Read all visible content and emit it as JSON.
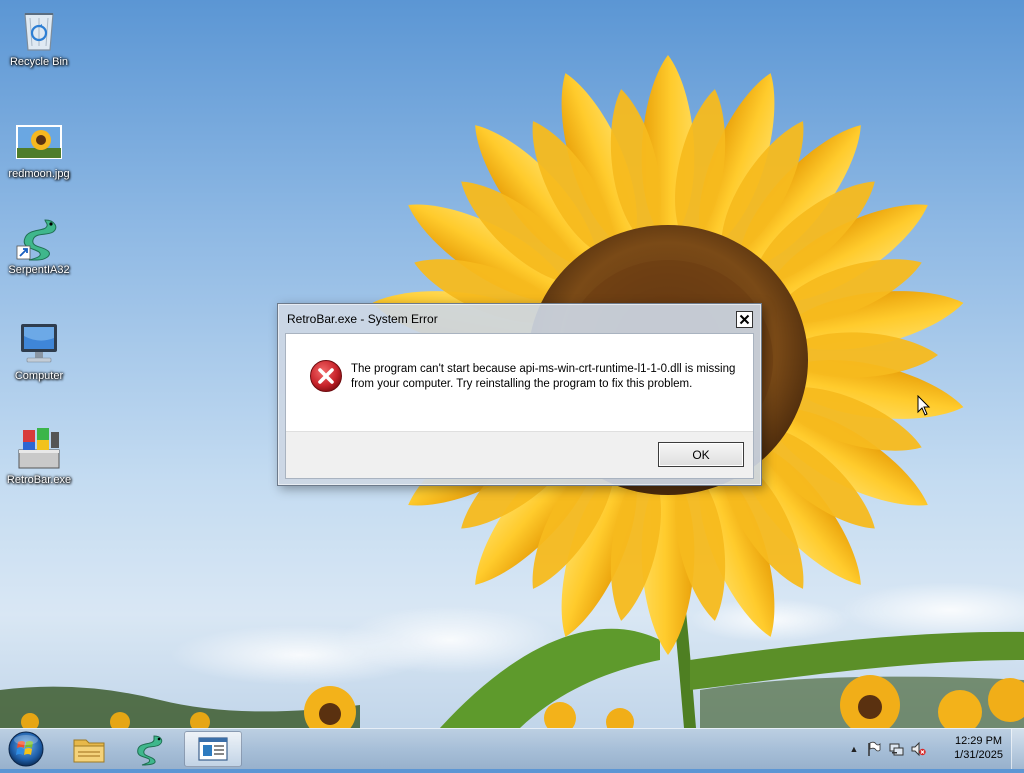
{
  "desktop": {
    "icons": [
      {
        "label": "Recycle Bin"
      },
      {
        "label": "redmoon.jpg"
      },
      {
        "label": "SerpentIA32"
      },
      {
        "label": "Computer"
      },
      {
        "label": "RetroBar.exe"
      }
    ]
  },
  "dialog": {
    "title": "RetroBar.exe - System Error",
    "message": "The program can't start because api-ms-win-crt-runtime-l1-1-0.dll is missing from your computer. Try reinstalling the program to fix this problem.",
    "ok_label": "OK",
    "close_glyph": "✕"
  },
  "taskbar": {
    "items": [
      {
        "icon": "file-explorer-icon"
      },
      {
        "icon": "serpent-icon"
      },
      {
        "icon": "retrobar-window-icon",
        "active": true
      }
    ]
  },
  "tray": {
    "overflow_glyph": "▲",
    "time": "12:29 PM",
    "date": "1/31/2025"
  },
  "colors": {
    "error_red": "#c8232b",
    "taskbar": "#a7bfd8",
    "sky": "#5b96d4"
  }
}
